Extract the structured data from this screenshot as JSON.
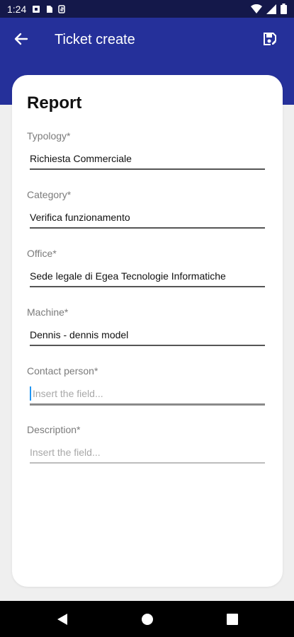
{
  "status_bar": {
    "time": "1:24",
    "icons": [
      "notification-icon",
      "sd-card-icon",
      "sync-icon"
    ],
    "right_icons": [
      "wifi-icon",
      "cellular-icon",
      "battery-icon"
    ]
  },
  "app_bar": {
    "title": "Ticket create",
    "back_icon": "arrow-back-icon",
    "save_icon": "save-icon",
    "color": "#25309a"
  },
  "form": {
    "heading": "Report",
    "fields": [
      {
        "label": "Typology*",
        "value": "Richiesta Commerciale"
      },
      {
        "label": "Category*",
        "value": "Verifica funzionamento"
      },
      {
        "label": "Office*",
        "value": "Sede legale di Egea Tecnologie Informatiche"
      },
      {
        "label": "Machine*",
        "value": "Dennis - dennis model"
      },
      {
        "label": "Contact person*",
        "placeholder": "Insert the field..."
      },
      {
        "label": "Description*",
        "placeholder": "Insert the field..."
      }
    ]
  },
  "nav_bar": {
    "icons": [
      "back-triangle-icon",
      "home-circle-icon",
      "recents-square-icon"
    ]
  }
}
